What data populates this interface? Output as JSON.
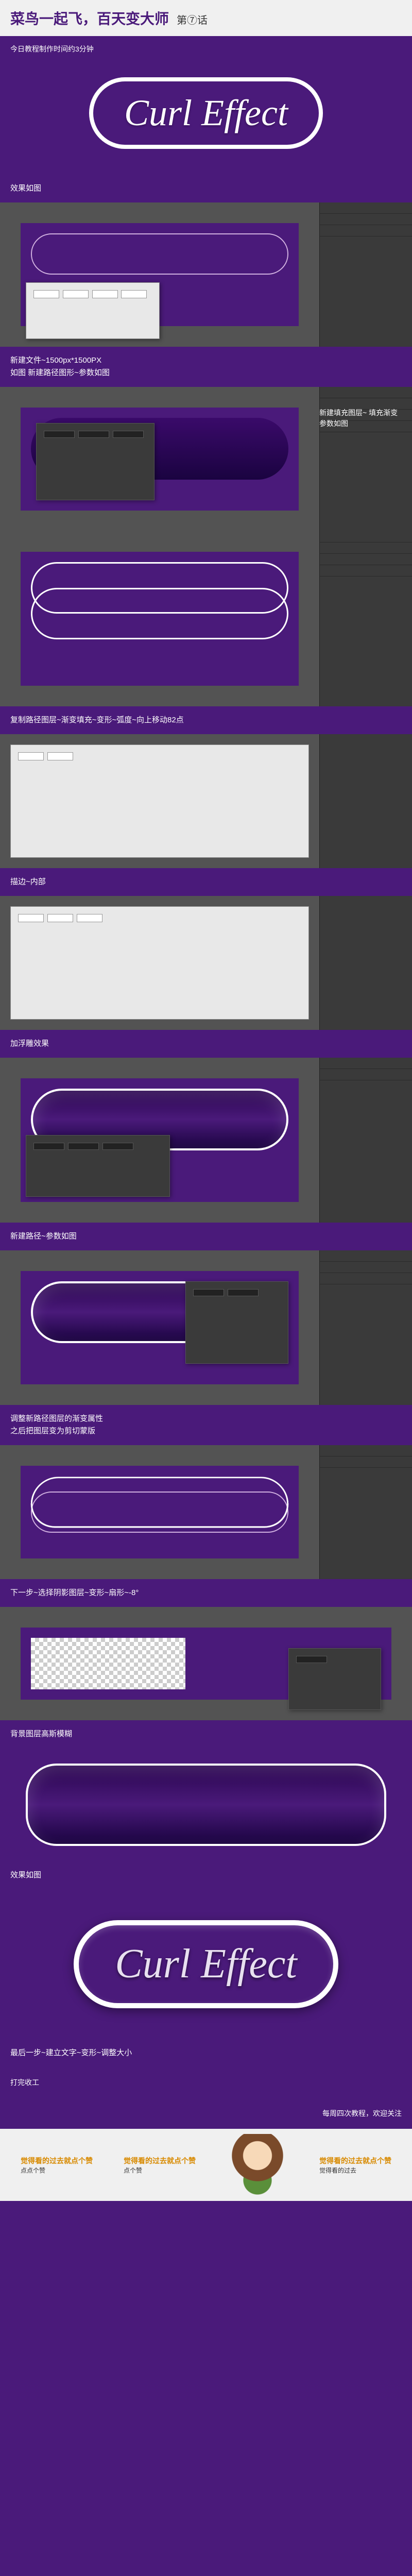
{
  "header": {
    "title": "菜鸟一起飞，百天变大师",
    "episode": "第⑦话"
  },
  "subtitle": "今日教程制作时间约3分钟",
  "hero_text": "Curl Effect",
  "steps": {
    "s1": "效果如图",
    "s2": "新建文件~1500px*1500PX\n如图 新建路径图形~参数如图",
    "s3": "新建填充图层~\n填充渐变\n参数如图",
    "s4": "复制路径图层~渐变填充~变形~弧度~向上移动82点",
    "s5": "描边~内部",
    "s6": "加浮雕效果",
    "s7": "新建路径~参数如图",
    "s8": "调整新路径图层的渐变属性\n之后把图层变为剪切蒙版",
    "s9": "下一步~选择阴影图层~变形~扇形~-8°",
    "s10": "背景图层高斯模糊",
    "s11": "效果如图",
    "s12": "最后一步~建立文字~变形~调整大小",
    "s13": "打完收工"
  },
  "footer": {
    "schedule": "每周四次教程，欢迎关注"
  },
  "sticker": {
    "vote1": "觉得看的过去就点个赞",
    "vote2": "点点个赞",
    "vote3": "觉得看的过去就点个赞",
    "vote4": "点个赞",
    "vote5": "觉得看的过去"
  },
  "final_text": "Curl Effect"
}
